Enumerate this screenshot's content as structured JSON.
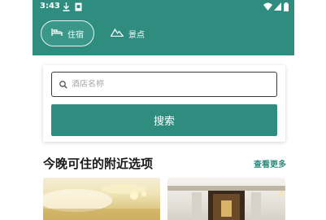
{
  "status_bar": {
    "time": "3:43"
  },
  "tabs": [
    {
      "label": "住宿",
      "icon": "bed-icon",
      "active": true
    },
    {
      "label": "景点",
      "icon": "mountain-icon",
      "active": false
    }
  ],
  "search": {
    "placeholder": "酒店名称",
    "value": "",
    "button_label": "搜索"
  },
  "section": {
    "title": "今晚可住的附近选项",
    "see_more": "查看更多"
  },
  "colors": {
    "brand": "#2f8d80",
    "text": "#1a1a1a",
    "placeholder": "#a6a6a6"
  }
}
